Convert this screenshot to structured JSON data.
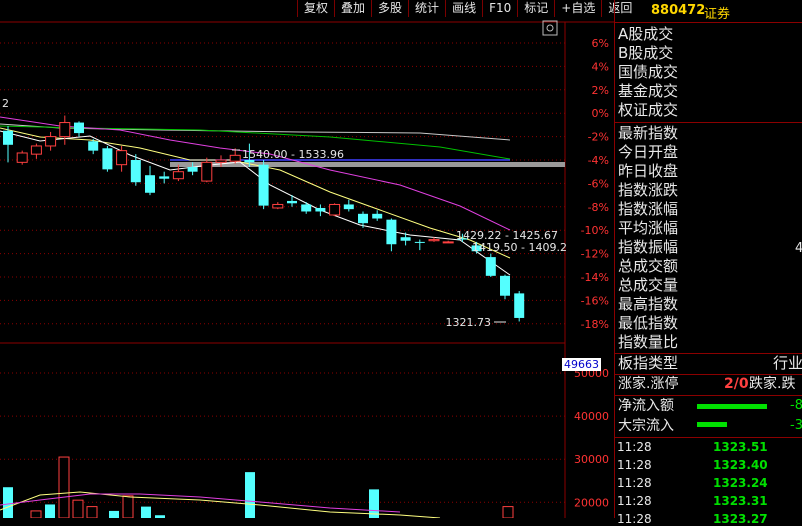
{
  "toolbar": [
    "复权",
    "叠加",
    "多股",
    "统计",
    "画线",
    "F10",
    "标记",
    "+自选",
    "返回"
  ],
  "header": {
    "code": "880472",
    "name": "证券"
  },
  "stats": [
    "A股成交",
    "B股成交",
    "国债成交",
    "基金成交",
    "权证成交",
    "最新指数",
    "今日开盘",
    "昨日收盘",
    "指数涨跌",
    "指数涨幅",
    "平均涨幅",
    "指数振幅",
    "总成交额",
    "总成交量",
    "最高指数",
    "最低指数",
    "指数量比"
  ],
  "stat_side_value": "4",
  "board": {
    "label": "板指类型",
    "value": "行业"
  },
  "limit": {
    "up_label": "涨家.涨停",
    "up_value": "2/0",
    "down_label": "跌家.跌"
  },
  "flows": [
    {
      "label": "净流入额",
      "value": "-8"
    },
    {
      "label": "大宗流入",
      "value": "-3"
    }
  ],
  "ticks": [
    {
      "time": "11:28",
      "price": "1323.51"
    },
    {
      "time": "11:28",
      "price": "1323.40"
    },
    {
      "time": "11:28",
      "price": "1323.24"
    },
    {
      "time": "11:28",
      "price": "1323.31"
    },
    {
      "time": "11:28",
      "price": "1323.27"
    }
  ],
  "volume_badge": "49663",
  "annotations": {
    "a1": "1540.00 - 1533.96",
    "a2": "1429.22 - 1425.67",
    "a3": "1419.50 - 1409.2",
    "low": "1321.73",
    "left_mark": "2"
  },
  "chart_data": {
    "type": "candlestick",
    "price_axis_ticks": [
      "6%",
      "4%",
      "2%",
      "0%",
      "-2%",
      "-4%",
      "-6%",
      "-8%",
      "-10%",
      "-12%",
      "-14%",
      "-16%",
      "-18%"
    ],
    "volume_axis_ticks": [
      "50000",
      "40000",
      "30000",
      "20000"
    ],
    "candles": [
      {
        "o": -1.5,
        "h": -1.1,
        "l": -4.2,
        "c": -2.7,
        "up": false
      },
      {
        "o": -4.2,
        "h": -3.2,
        "l": -4.4,
        "c": -3.4,
        "up": true
      },
      {
        "o": -3.5,
        "h": -2.6,
        "l": -3.9,
        "c": -2.8,
        "up": true
      },
      {
        "o": -2.8,
        "h": -1.6,
        "l": -3.2,
        "c": -2.0,
        "up": true
      },
      {
        "o": -2.0,
        "h": -0.2,
        "l": -2.7,
        "c": -0.8,
        "up": true
      },
      {
        "o": -0.8,
        "h": -0.7,
        "l": -2.0,
        "c": -1.7,
        "up": false
      },
      {
        "o": -2.4,
        "h": -2.2,
        "l": -3.5,
        "c": -3.2,
        "up": false
      },
      {
        "o": -3.0,
        "h": -2.8,
        "l": -5.0,
        "c": -4.8,
        "up": false
      },
      {
        "o": -3.2,
        "h": -2.8,
        "l": -5.0,
        "c": -4.4,
        "up": true
      },
      {
        "o": -4.0,
        "h": -3.5,
        "l": -6.2,
        "c": -5.9,
        "up": false
      },
      {
        "o": -5.3,
        "h": -4.5,
        "l": -7.0,
        "c": -6.8,
        "up": false
      },
      {
        "o": -5.6,
        "h": -5.0,
        "l": -6.0,
        "c": -5.4,
        "up": false
      },
      {
        "o": -5.6,
        "h": -4.4,
        "l": -5.8,
        "c": -5.0,
        "up": true
      },
      {
        "o": -5.0,
        "h": -4.2,
        "l": -5.3,
        "c": -4.6,
        "up": false
      },
      {
        "o": -5.8,
        "h": -3.8,
        "l": -5.9,
        "c": -4.2,
        "up": true
      },
      {
        "o": -4.2,
        "h": -3.6,
        "l": -4.6,
        "c": -4.0,
        "up": true
      },
      {
        "o": -4.1,
        "h": -3.0,
        "l": -4.3,
        "c": -3.6,
        "up": true
      },
      {
        "o": -4.0,
        "h": -2.6,
        "l": -4.6,
        "c": -4.2,
        "up": false
      },
      {
        "o": -4.4,
        "h": -4.0,
        "l": -8.2,
        "c": -7.9,
        "up": false
      },
      {
        "o": -8.1,
        "h": -7.6,
        "l": -8.2,
        "c": -7.8,
        "up": true
      },
      {
        "o": -7.5,
        "h": -7.0,
        "l": -8.0,
        "c": -7.7,
        "up": false
      },
      {
        "o": -7.8,
        "h": -7.6,
        "l": -8.6,
        "c": -8.4,
        "up": false
      },
      {
        "o": -8.1,
        "h": -7.8,
        "l": -8.8,
        "c": -8.4,
        "up": false
      },
      {
        "o": -8.7,
        "h": -7.7,
        "l": -8.8,
        "c": -7.8,
        "up": true
      },
      {
        "o": -7.8,
        "h": -7.4,
        "l": -8.4,
        "c": -8.2,
        "up": false
      },
      {
        "o": -8.6,
        "h": -8.4,
        "l": -9.8,
        "c": -9.4,
        "up": false
      },
      {
        "o": -8.6,
        "h": -8.3,
        "l": -9.2,
        "c": -9.0,
        "up": false
      },
      {
        "o": -9.1,
        "h": -9.0,
        "l": -11.8,
        "c": -11.2,
        "up": false
      },
      {
        "o": -10.6,
        "h": -10.2,
        "l": -11.3,
        "c": -10.9,
        "up": false
      },
      {
        "o": -11.0,
        "h": -10.8,
        "l": -11.7,
        "c": -11.0,
        "up": false
      },
      {
        "o": -10.8,
        "h": -10.6,
        "l": -11.0,
        "c": -10.9,
        "up": true
      },
      {
        "o": -11.0,
        "h": -10.9,
        "l": -11.1,
        "c": -11.0,
        "up": true
      },
      {
        "o": -10.8,
        "h": -10.3,
        "l": -11.0,
        "c": -10.7,
        "up": false
      },
      {
        "o": -11.3,
        "h": -11.0,
        "l": -12.0,
        "c": -11.8,
        "up": false
      },
      {
        "o": -12.3,
        "h": -12.0,
        "l": -14.0,
        "c": -13.9,
        "up": false
      },
      {
        "o": -13.9,
        "h": -13.8,
        "l": -15.9,
        "c": -15.6,
        "up": false
      },
      {
        "o": -15.4,
        "h": -15.2,
        "l": -17.8,
        "c": -17.5,
        "up": false
      }
    ],
    "volumes": [
      23500,
      null,
      18000,
      19500,
      30500,
      20500,
      19000,
      18000,
      21500,
      19000,
      17000,
      null,
      null,
      17500,
      16500,
      null,
      17000,
      null,
      27000,
      null,
      16000,
      15500,
      null,
      null,
      null,
      null,
      null,
      null,
      null,
      23000,
      null,
      null,
      null,
      null,
      15000,
      null,
      19000,
      20500,
      null,
      null,
      null,
      null,
      null,
      null,
      null,
      null,
      null,
      null,
      null,
      null,
      null,
      null,
      null,
      null,
      null,
      null,
      null,
      null,
      null,
      null,
      null,
      null,
      null,
      null,
      null,
      null,
      null,
      null
    ]
  }
}
